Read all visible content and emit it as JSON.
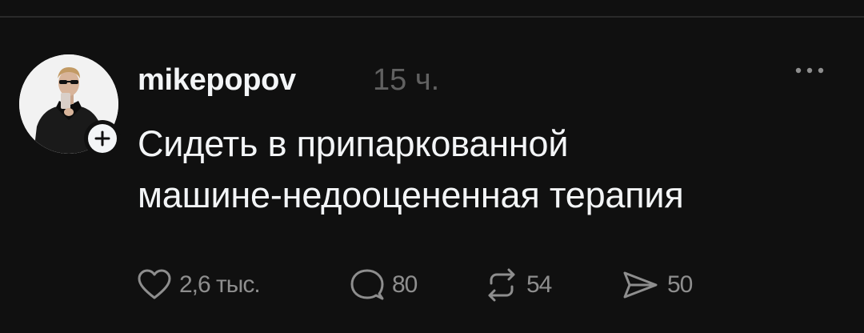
{
  "post": {
    "username": "mikepopov",
    "timestamp": "15 ч.",
    "text_lines": [
      "Сидеть в припаркованной",
      "машине-недооцененная терапия"
    ]
  },
  "actions": {
    "likes": "2,6 тыс.",
    "replies": "80",
    "reposts": "54",
    "shares": "50"
  },
  "icons": {
    "more": "more-horizontal-icon",
    "follow": "plus-icon",
    "like": "heart-icon",
    "reply": "comment-bubble-icon",
    "repost": "repost-icon",
    "share": "send-icon"
  },
  "colors": {
    "background": "#101010",
    "primary_text": "#f3f5f7",
    "secondary_text": "#616161",
    "icon": "#8e8e8e"
  }
}
